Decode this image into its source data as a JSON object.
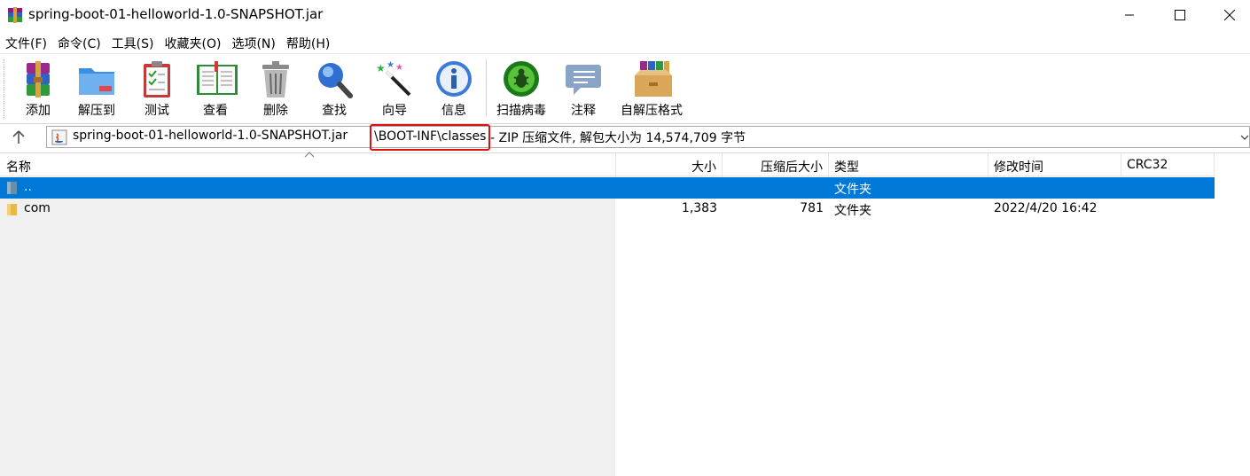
{
  "window": {
    "title": "spring-boot-01-helloworld-1.0-SNAPSHOT.jar"
  },
  "menu": [
    {
      "label": "文件(F)"
    },
    {
      "label": "命令(C)"
    },
    {
      "label": "工具(S)"
    },
    {
      "label": "收藏夹(O)"
    },
    {
      "label": "选项(N)"
    },
    {
      "label": "帮助(H)"
    }
  ],
  "toolbar": {
    "add": "添加",
    "extract": "解压到",
    "test": "测试",
    "view": "查看",
    "delete": "删除",
    "find": "查找",
    "wizard": "向导",
    "info": "信息",
    "virus_scan": "扫描病毒",
    "comment": "注释",
    "sfx": "自解压格式"
  },
  "address": {
    "archive": "spring-boot-01-helloworld-1.0-SNAPSHOT.jar",
    "path": "\\BOOT-INF\\classes",
    "description": "- ZIP 压缩文件, 解包大小为 14,574,709 字节",
    "highlight_color": "#e01010"
  },
  "columns": {
    "name": "名称",
    "size": "大小",
    "packed": "压缩后大小",
    "type": "类型",
    "modified": "修改时间",
    "crc": "CRC32"
  },
  "rows": [
    {
      "name": "..",
      "size": "",
      "packed": "",
      "type": "文件夹",
      "modified": "",
      "crc": "",
      "selected": true
    },
    {
      "name": "com",
      "size": "1,383",
      "packed": "781",
      "type": "文件夹",
      "modified": "2022/4/20 16:42",
      "crc": "",
      "selected": false
    }
  ],
  "colors": {
    "selection": "#0078d7",
    "folder": "#e8b84a"
  }
}
